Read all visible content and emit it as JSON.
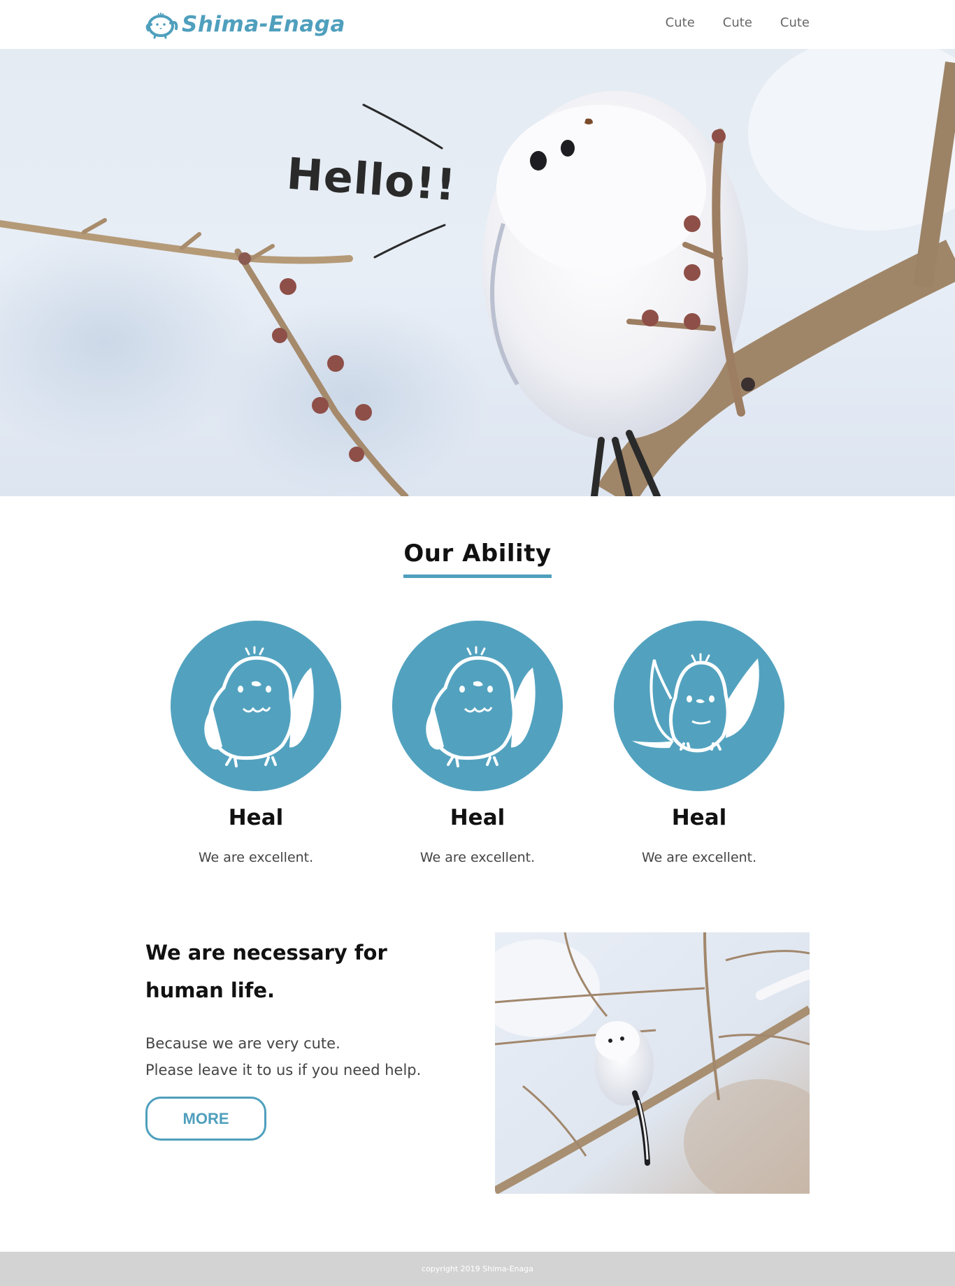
{
  "header": {
    "logo_text": "Shima-Enaga",
    "nav": [
      "Cute",
      "Cute",
      "Cute"
    ]
  },
  "hero": {
    "speech_text": "Hello!!"
  },
  "ability": {
    "title": "Our Ability",
    "items": [
      {
        "title": "Heal",
        "text": "We are excellent.",
        "icon": "bird-wing-up-icon"
      },
      {
        "title": "Heal",
        "text": "We are excellent.",
        "icon": "bird-wing-up-icon"
      },
      {
        "title": "Heal",
        "text": "We are excellent.",
        "icon": "bird-wings-spread-icon"
      }
    ]
  },
  "feature": {
    "heading_line1": "We are necessary for",
    "heading_line2": "human life.",
    "desc_line1": "Because we are very cute.",
    "desc_line2": "Please leave it to us if you need help.",
    "button": "MORE"
  },
  "footer": {
    "copyright": "copyright 2019 Shima-Enaga"
  },
  "colors": {
    "accent": "#4f9fbd",
    "circle": "#52a2bf",
    "footer_bg": "#d3d3d3"
  }
}
